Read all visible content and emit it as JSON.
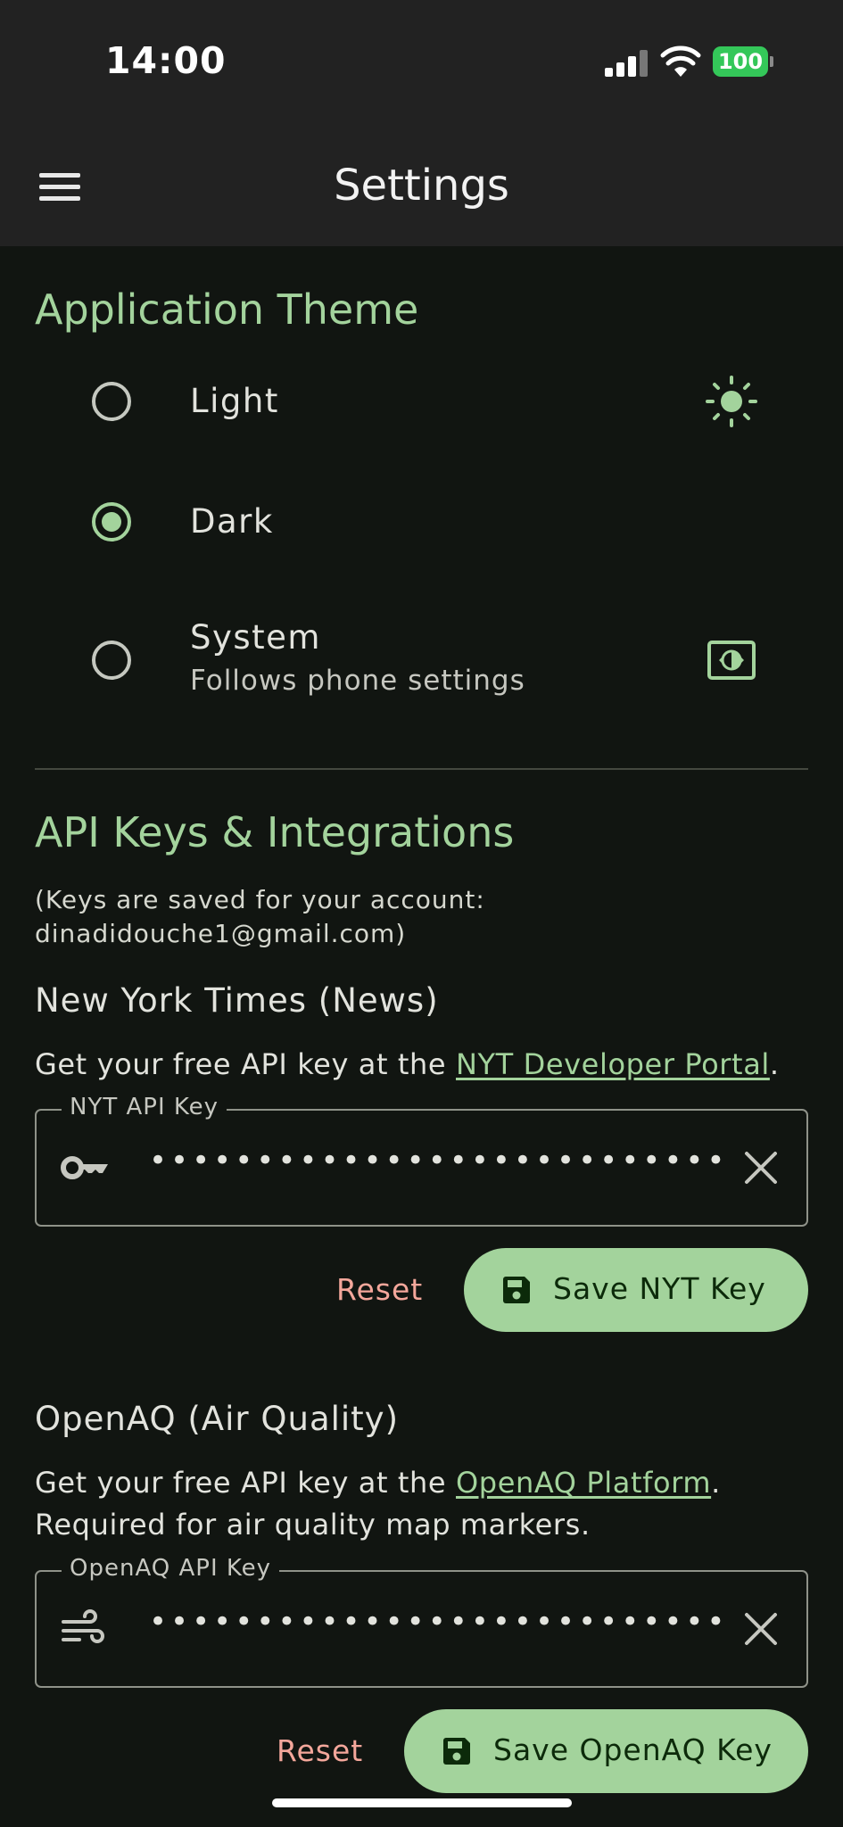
{
  "status_bar": {
    "time": "14:00",
    "battery": "100"
  },
  "app_bar": {
    "title": "Settings"
  },
  "theme_section": {
    "title": "Application Theme",
    "options": [
      {
        "label": "Light",
        "subtitle": "",
        "selected": false,
        "icon": "sun-icon"
      },
      {
        "label": "Dark",
        "subtitle": "",
        "selected": true,
        "icon": "moon-icon"
      },
      {
        "label": "System",
        "subtitle": "Follows phone settings",
        "selected": false,
        "icon": "brightness-auto-icon"
      }
    ]
  },
  "api_section": {
    "title": "API Keys & Integrations",
    "account_note": "(Keys are saved for your account: dinadidouche1@gmail.com)",
    "nyt": {
      "title": "New York Times (News)",
      "desc_prefix": "Get your free API key at the ",
      "link": "NYT Developer Portal",
      "desc_suffix": ".",
      "field_label": "NYT API Key",
      "field_value": "••••••••••••••••••••••••••••••••",
      "reset_label": "Reset",
      "save_label": "Save NYT Key",
      "icon": "key-icon"
    },
    "openaq": {
      "title": "OpenAQ (Air Quality)",
      "desc_prefix": "Get your free API key at the ",
      "link": "OpenAQ Platform",
      "desc_suffix": ".",
      "desc_line2": "Required for air quality map markers.",
      "field_label": "OpenAQ API Key",
      "field_value": "••••••••••••••••••••••••••••••••",
      "reset_label": "Reset",
      "save_label": "Save OpenAQ Key",
      "icon": "air-icon"
    }
  },
  "colors": {
    "accent": "#a3d39c",
    "reset": "#f4a79b",
    "background": "#111511",
    "bar": "#222222"
  }
}
